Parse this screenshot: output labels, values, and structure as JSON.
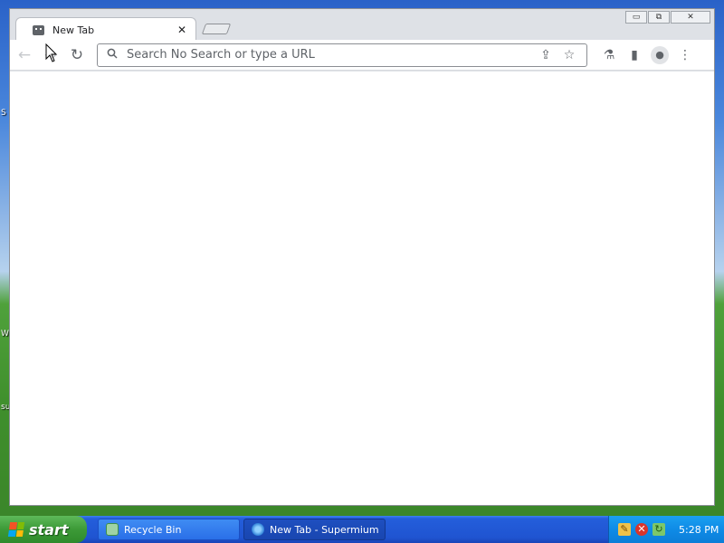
{
  "desktop": {
    "fragments": [
      "S",
      "W",
      "su"
    ]
  },
  "browser": {
    "tab": {
      "title": "New Tab",
      "close_glyph": "✕"
    },
    "window_controls": {
      "minimize": "▭",
      "maximize": "⧉",
      "close": "✕"
    },
    "toolbar": {
      "back_glyph": "←",
      "forward_glyph": "→",
      "reload_glyph": "↻",
      "omnibox_placeholder": "Search No Search or type a URL",
      "omnibox_value": "",
      "share_glyph": "⇪",
      "bookmark_glyph": "☆",
      "labs_glyph": "⚗",
      "sidepanel_glyph": "▮",
      "profile_glyph": "●",
      "menu_glyph": "⋮"
    }
  },
  "taskbar": {
    "start_label": "start",
    "items": [
      {
        "label": "Recycle Bin"
      },
      {
        "label": "New Tab - Supermium"
      }
    ],
    "tray": {
      "time": "5:28 PM"
    }
  },
  "colors": {
    "taskbar_blue": "#245edb",
    "start_green": "#3c9a37",
    "tray_blue": "#0f8be6"
  }
}
